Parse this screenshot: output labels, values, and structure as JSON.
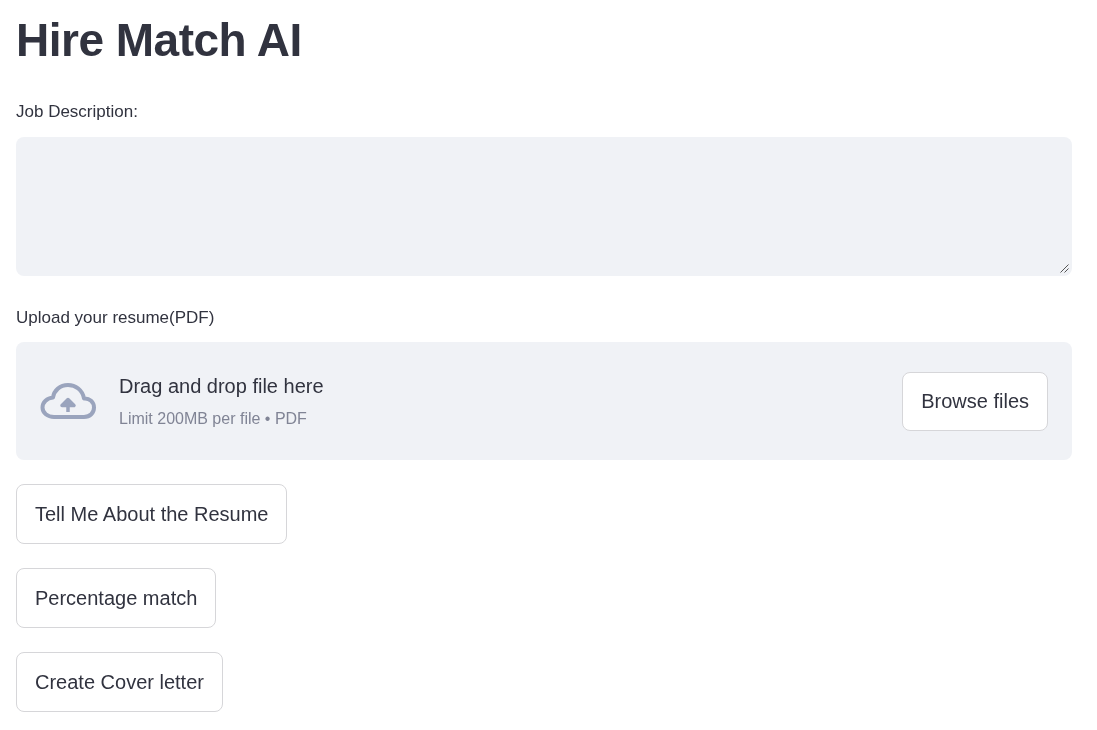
{
  "title": "Hire Match AI",
  "job_description": {
    "label": "Job Description:"
  },
  "resume_upload": {
    "label": "Upload your resume(PDF)",
    "dropzone_text": "Drag and drop file here",
    "limit_text": "Limit 200MB per file • PDF",
    "button": "Browse files"
  },
  "buttons": [
    "Tell Me About the Resume",
    "Percentage match",
    "Create Cover letter"
  ]
}
